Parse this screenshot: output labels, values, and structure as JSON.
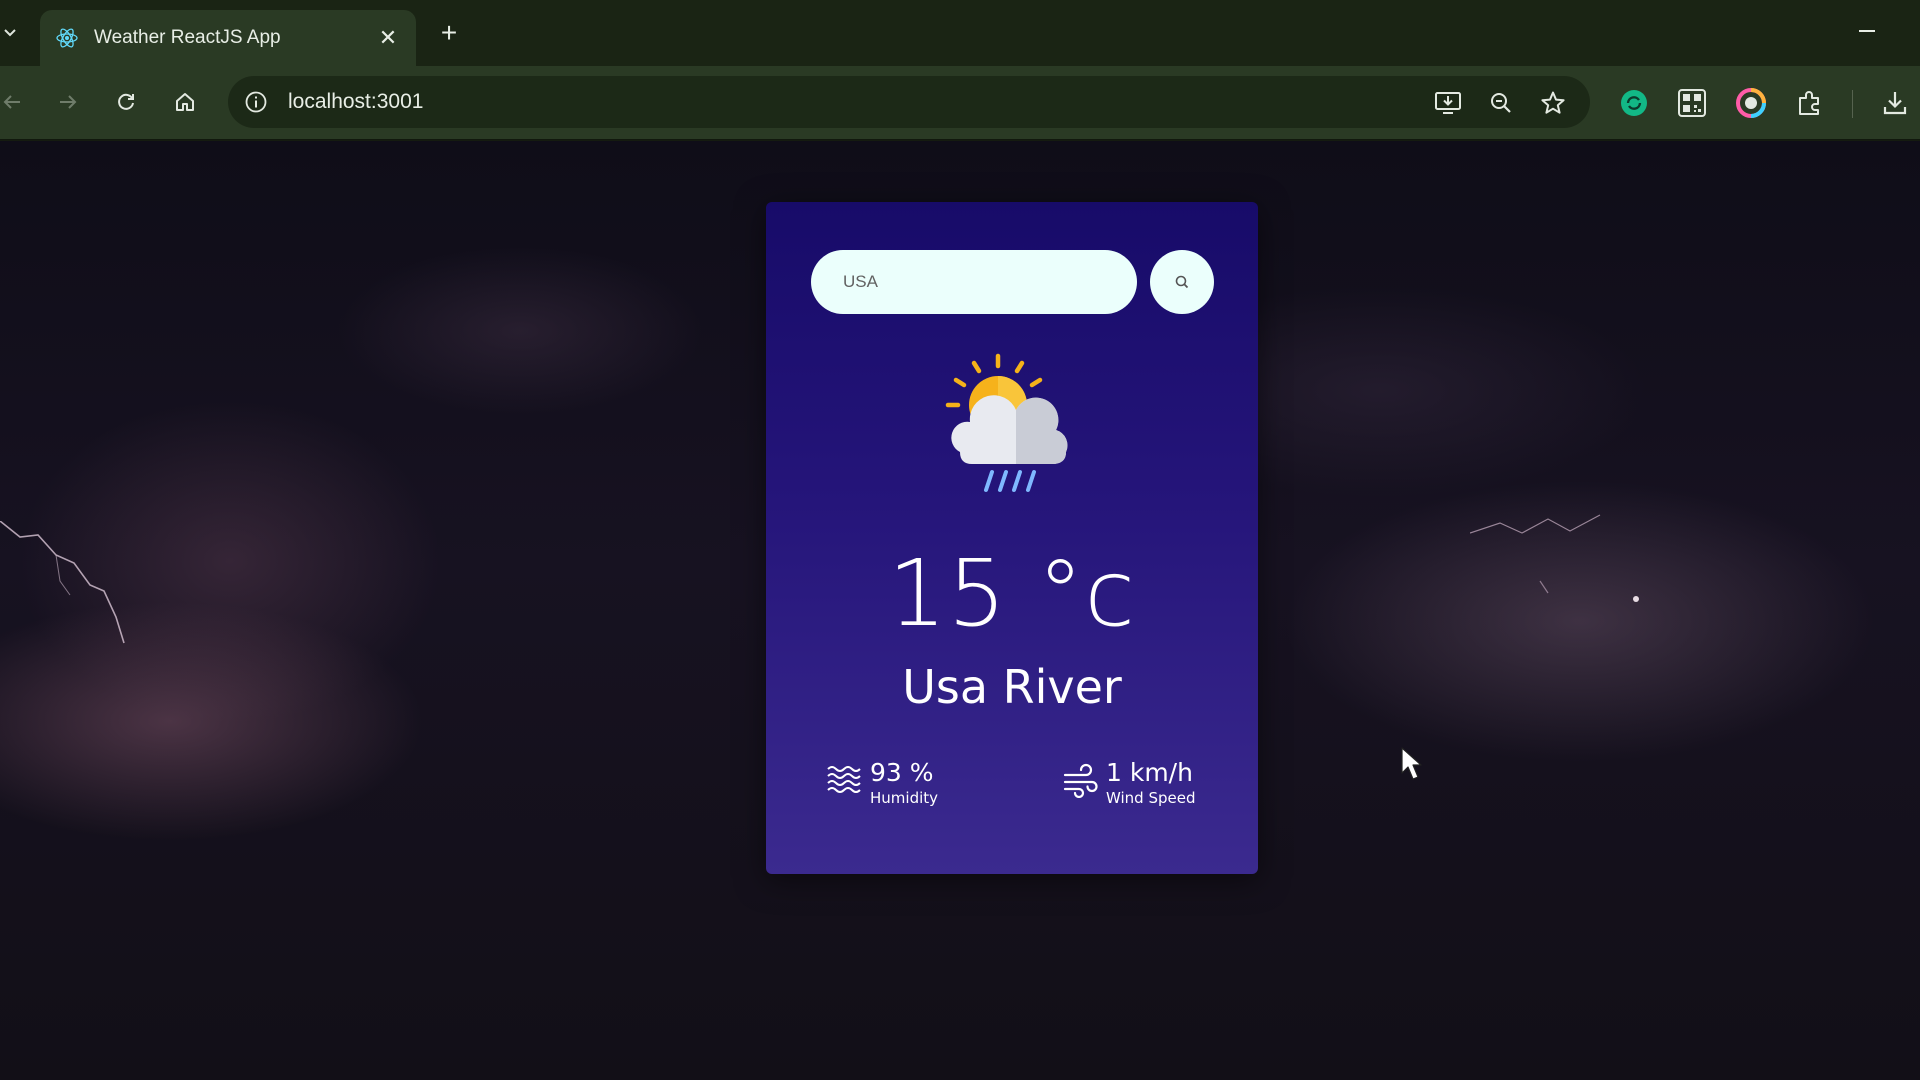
{
  "browser": {
    "tab_title": "Weather ReactJS App",
    "new_tab_label": "+",
    "close_tab_label": "✕",
    "url": "localhost:3001",
    "tab_favicon": "react-icon"
  },
  "page": {
    "search": {
      "value": "USA",
      "placeholder": "Search"
    },
    "weather_icon": "rain-sun-cloud-icon",
    "temperature": "15 °c",
    "city": "Usa River",
    "humidity": {
      "value": "93 %",
      "label": "Humidity",
      "icon": "humidity-icon"
    },
    "wind": {
      "value": "1 km/h",
      "label": "Wind Speed",
      "icon": "wind-icon"
    }
  },
  "colors": {
    "card_top": "#170b69",
    "card_bottom": "#3b2a8f",
    "input_bg": "#ebfffc",
    "browser_frame": "#2a3a24"
  }
}
